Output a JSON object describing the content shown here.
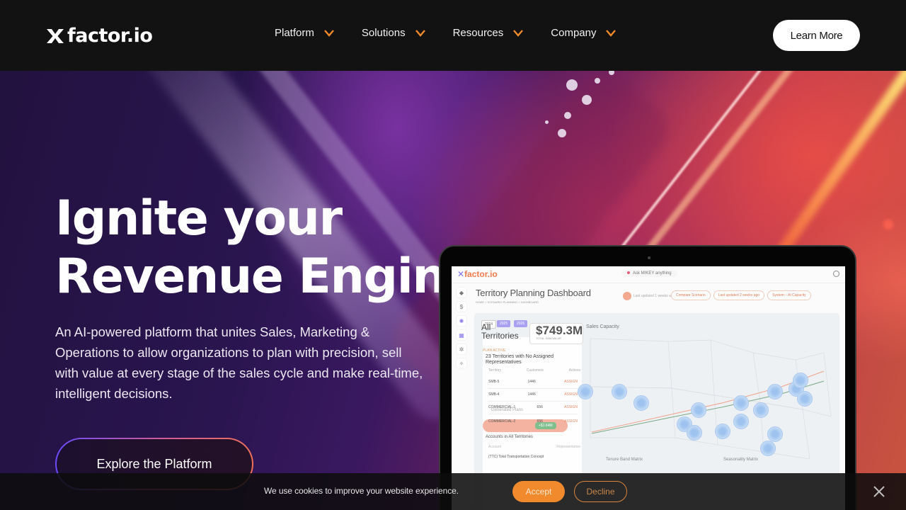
{
  "nav": {
    "logo_text": "factor.io",
    "menu": [
      {
        "label": "Platform"
      },
      {
        "label": "Solutions"
      },
      {
        "label": "Resources"
      },
      {
        "label": "Company"
      }
    ],
    "cta_label": "Learn More"
  },
  "hero": {
    "title_line1": "Ignite your",
    "title_line2": "Revenue Engine",
    "description": "An AI-powered platform that unites Sales, Marketing & Operations to allow organizations to plan with precision, sell with value at every stage of the sales cycle and make real-time, intelligent decisions.",
    "cta_label": "Explore the Platform"
  },
  "dashboard": {
    "logo_text": "factor.io",
    "ask": "Ask MIKEY anything",
    "title": "Territory Planning Dashboard",
    "breadcrumb": "HOME  >  SCENARIO PLANNING  >  DASHBOARD",
    "last_updated": "Last updated 1 weeks ago",
    "chips": [
      "Compare Scenario",
      "Last updated 2 weeks ago",
      "System – AI Capacity"
    ],
    "years": [
      "2024",
      "2025",
      "2026"
    ],
    "all_territories": "All Territories",
    "total_value": "$749.3M",
    "total_value_label": "TOTAL SAM VALUE",
    "plan_status": "PLAN ACTIVE",
    "warning": "23 Territories with No Assigned Representatives",
    "table_headers": [
      "Territory",
      "Customers",
      "Actions"
    ],
    "table_rows": [
      {
        "territory": "SMB-5",
        "customers": "1446",
        "action": "ASSIGN"
      },
      {
        "territory": "SMB-4",
        "customers": "1446",
        "action": "ASSIGN"
      },
      {
        "territory": "COMMERCIAL-1",
        "customers": "656",
        "action": "ASSIGN"
      },
      {
        "territory": "COMMERCIAL-2",
        "customers": "656",
        "action": "ASSIGN"
      }
    ],
    "generated_plans": "Generated Plans",
    "plan_amount": "+$1.64M",
    "accounts_title": "Accounts in All Territories",
    "accounts_headers": [
      "Account",
      "Representative"
    ],
    "account_row": "(TTC) Total Transportation Concept",
    "sales_capacity": "Sales Capacity",
    "tenure_matrix": "Tenure Band Matrix",
    "seasonality_matrix": "Seasonality Matrix"
  },
  "cookie": {
    "text": "We use cookies to improve your website experience.",
    "accept_label": "Accept",
    "decline_label": "Decline"
  },
  "colors": {
    "accent_orange": "#f08a2c",
    "nav_bg": "#121212",
    "brand_purple": "#8070ee"
  }
}
